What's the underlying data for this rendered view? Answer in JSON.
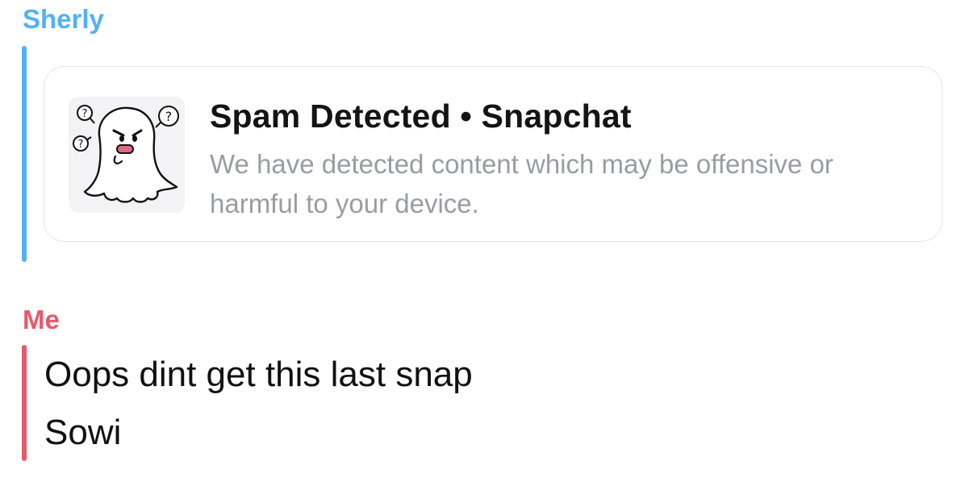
{
  "colors": {
    "sherly": "#52b1f5",
    "me": "#e8596a",
    "title": "#141414",
    "description": "#9a9ca3"
  },
  "messages": [
    {
      "sender": "Sherly",
      "link_card": {
        "icon": "ghost-icon",
        "title": "Spam Detected • Snapchat",
        "description": "We have detected content which may be offensive or harmful to your device."
      }
    },
    {
      "sender": "Me",
      "lines": [
        "Oops dint get this last snap",
        "Sowi"
      ]
    }
  ]
}
